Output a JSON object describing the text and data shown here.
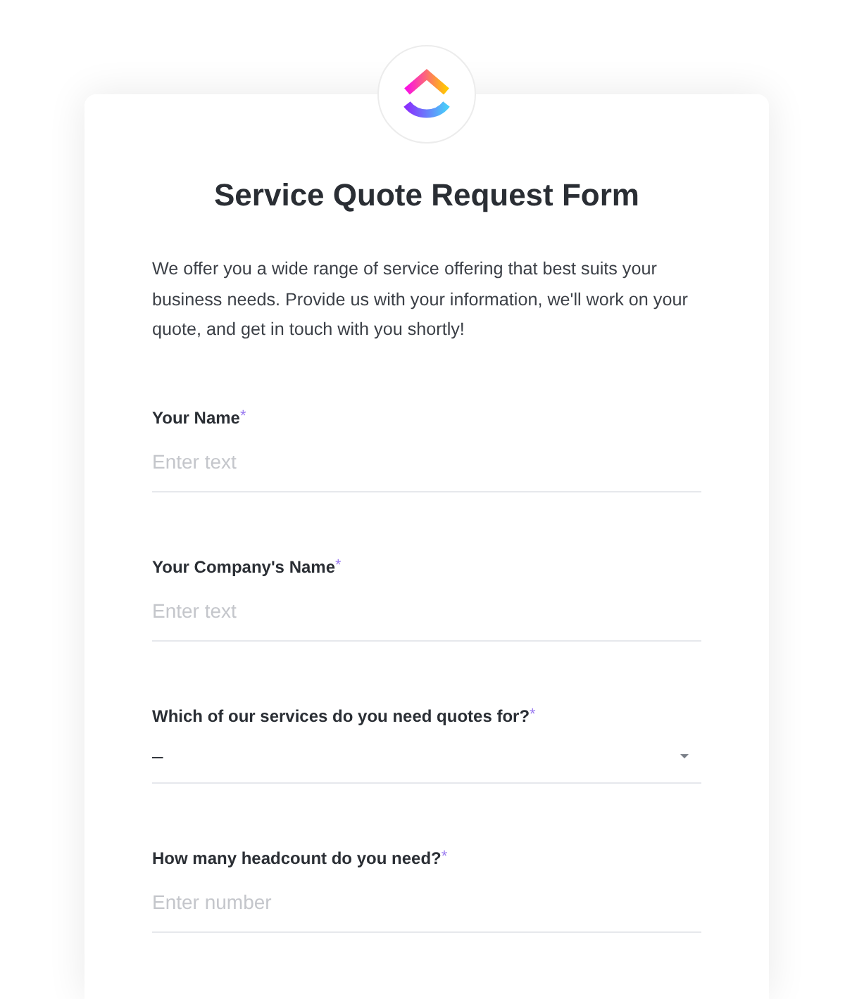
{
  "form": {
    "title": "Service Quote Request Form",
    "description": "We offer you a wide range of service offering that best suits your business needs. Provide us with your information, we'll work on your quote, and get in touch with you shortly!",
    "fields": [
      {
        "kind": "text",
        "label": "Your Name",
        "required_mark": "*",
        "placeholder": "Enter text"
      },
      {
        "kind": "text",
        "label": "Your Company's Name",
        "required_mark": "*",
        "placeholder": "Enter text"
      },
      {
        "kind": "select",
        "label": "Which of our services do you need quotes for?",
        "required_mark": "*",
        "value": "–"
      },
      {
        "kind": "number",
        "label": "How many headcount do you need?",
        "required_mark": "*",
        "placeholder": "Enter number"
      }
    ]
  }
}
